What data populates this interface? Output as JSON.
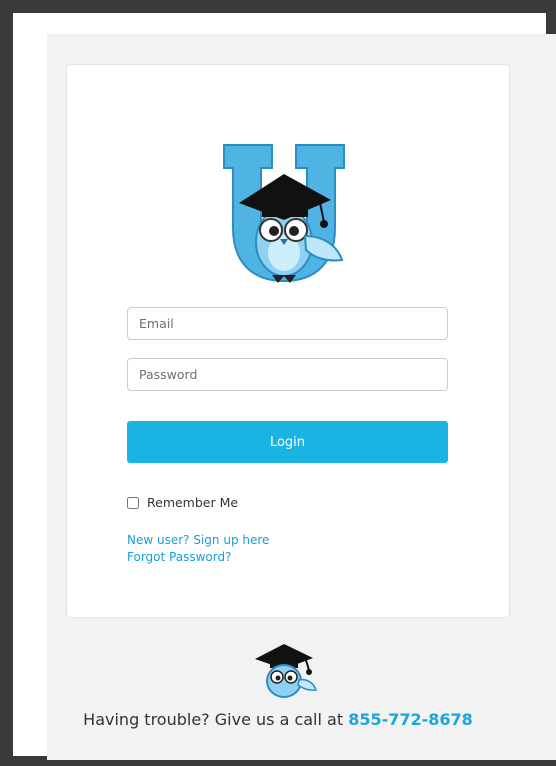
{
  "form": {
    "email_placeholder": "Email",
    "password_placeholder": "Password",
    "login_label": "Login",
    "remember_label": "Remember Me",
    "remember_checked": false,
    "signup_link": "New user? Sign up here",
    "forgot_link": "Forgot Password?"
  },
  "footer": {
    "help_text": "Having trouble? Give us a call at ",
    "phone": "855-772-8678"
  },
  "colors": {
    "accent": "#1bb3e2",
    "link": "#1a9fd6",
    "page_bg": "#f2f2f2",
    "frame": "#3a3a3a"
  },
  "icons": {
    "logo": "owl-graduate-u-logo",
    "footer_logo": "owl-graduate-icon"
  }
}
